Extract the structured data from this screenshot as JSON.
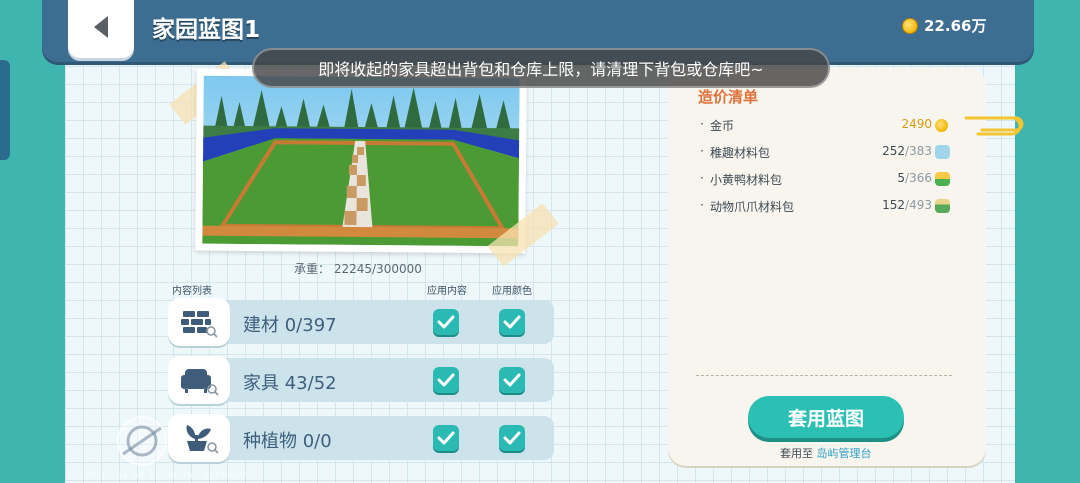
{
  "header": {
    "title": "家园蓝图1",
    "coins": "22.66万"
  },
  "toast": "即将收起的家具超出背包和仓库上限，请清理下背包或仓库吧~",
  "blueprint": {
    "capacity_label": "承重：",
    "capacity_value": "22245/300000"
  },
  "list": {
    "header_content": "内容列表",
    "header_apply_content": "应用内容",
    "header_apply_color": "应用颜色",
    "rows": [
      {
        "label": "建材 0/397",
        "icon": "bricks-icon",
        "apply_content": true,
        "apply_color": true
      },
      {
        "label": "家具 43/52",
        "icon": "armchair-icon",
        "apply_content": true,
        "apply_color": true
      },
      {
        "label": "种植物 0/0",
        "icon": "sprout-icon",
        "apply_content": true,
        "apply_color": true
      }
    ]
  },
  "cost": {
    "title": "造价清单",
    "items": [
      {
        "name": "金币",
        "value": "2490",
        "icon": "coin-icon"
      },
      {
        "name": "稚趣材料包",
        "have": "252",
        "need": "/383",
        "icon": "material-pack-blue-icon"
      },
      {
        "name": "小黄鸭材料包",
        "have": "5",
        "need": "/366",
        "icon": "material-pack-duck-icon"
      },
      {
        "name": "动物爪爪材料包",
        "have": "152",
        "need": "/493",
        "icon": "material-pack-paw-icon"
      }
    ],
    "apply_button": "套用蓝图",
    "apply_note_prefix": "套用至",
    "apply_note_target": "岛屿管理台"
  },
  "debug_text": "F: 30   T: 54.50   F: 30   Ib: 5kr4kwy7",
  "colors": {
    "header": "#3e6d92",
    "accent_teal": "#2bbab3",
    "cost_title": "#e0713b",
    "link": "#2f9fc4"
  }
}
